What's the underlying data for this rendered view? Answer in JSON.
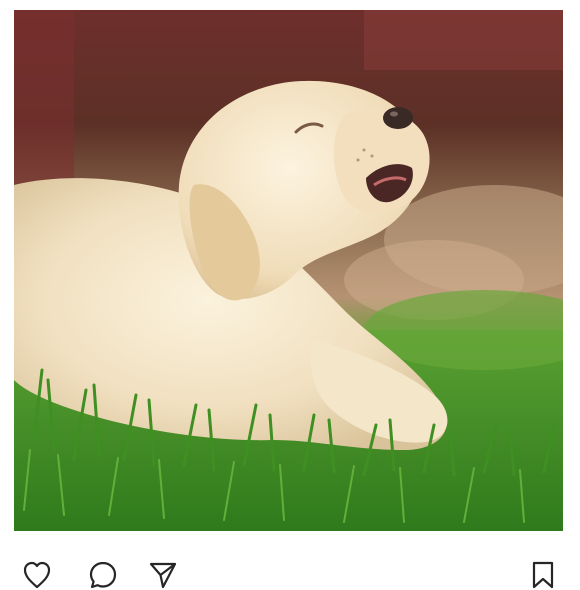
{
  "post": {
    "image": {
      "subject": "puppy-in-grass",
      "alt": ""
    },
    "actions": [
      {
        "name": "like-icon",
        "icon": "heart-outline"
      },
      {
        "name": "comment-icon",
        "icon": "speech-bubble-outline"
      },
      {
        "name": "share-icon",
        "icon": "paper-plane-outline"
      },
      {
        "name": "bookmark-icon",
        "icon": "bookmark-outline"
      }
    ]
  },
  "colors": {
    "background": "#ffffff",
    "icon_stroke": "#262626",
    "grass": "#4a8c2a",
    "fence": "#7a3a34",
    "fur": "#f3e4c8"
  }
}
